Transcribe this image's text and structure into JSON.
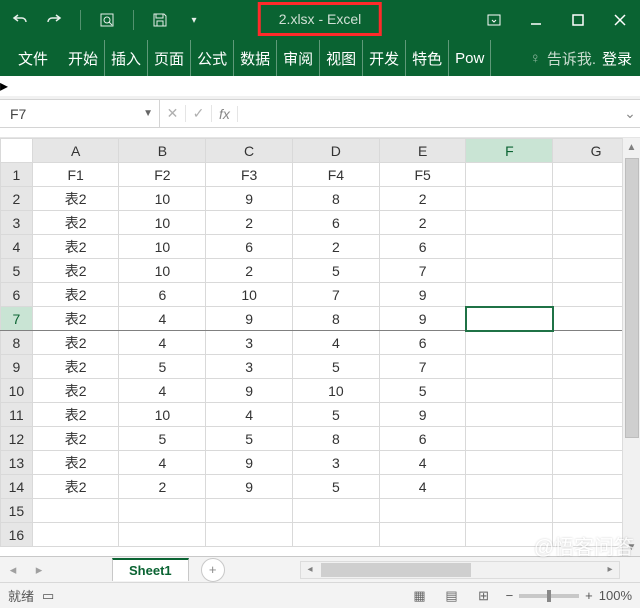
{
  "title": "2.xlsx - Excel",
  "ribbon_tabs": [
    "文件",
    "开始",
    "插入",
    "页面",
    "公式",
    "数据",
    "审阅",
    "视图",
    "开发",
    "特色",
    "Pow"
  ],
  "tell_me": "告诉我.",
  "login": "登录",
  "namebox": "F7",
  "formula": "",
  "columns": [
    "A",
    "B",
    "C",
    "D",
    "E",
    "F",
    "G"
  ],
  "row_numbers": [
    1,
    2,
    3,
    4,
    5,
    6,
    7,
    8,
    9,
    10,
    11,
    12,
    13,
    14,
    15,
    16
  ],
  "active_col": "F",
  "active_row": 7,
  "rows": [
    [
      "F1",
      "F2",
      "F3",
      "F4",
      "F5",
      "",
      ""
    ],
    [
      "表2",
      "10",
      "9",
      "8",
      "2",
      "",
      ""
    ],
    [
      "表2",
      "10",
      "2",
      "6",
      "2",
      "",
      ""
    ],
    [
      "表2",
      "10",
      "6",
      "2",
      "6",
      "",
      ""
    ],
    [
      "表2",
      "10",
      "2",
      "5",
      "7",
      "",
      ""
    ],
    [
      "表2",
      "6",
      "10",
      "7",
      "9",
      "",
      ""
    ],
    [
      "表2",
      "4",
      "9",
      "8",
      "9",
      "",
      ""
    ],
    [
      "表2",
      "4",
      "3",
      "4",
      "6",
      "",
      ""
    ],
    [
      "表2",
      "5",
      "3",
      "5",
      "7",
      "",
      ""
    ],
    [
      "表2",
      "4",
      "9",
      "10",
      "5",
      "",
      ""
    ],
    [
      "表2",
      "10",
      "4",
      "5",
      "9",
      "",
      ""
    ],
    [
      "表2",
      "5",
      "5",
      "8",
      "6",
      "",
      ""
    ],
    [
      "表2",
      "4",
      "9",
      "3",
      "4",
      "",
      ""
    ],
    [
      "表2",
      "2",
      "9",
      "5",
      "4",
      "",
      ""
    ],
    [
      "",
      "",
      "",
      "",
      "",
      "",
      ""
    ],
    [
      "",
      "",
      "",
      "",
      "",
      "",
      ""
    ]
  ],
  "sheet_tab": "Sheet1",
  "status": "就绪",
  "zoom": "100%",
  "watermark": "@悟客问答",
  "chart_data": {
    "type": "table",
    "columns": [
      "F1",
      "F2",
      "F3",
      "F4",
      "F5"
    ],
    "data": [
      [
        "表2",
        10,
        9,
        8,
        2
      ],
      [
        "表2",
        10,
        2,
        6,
        2
      ],
      [
        "表2",
        10,
        6,
        2,
        6
      ],
      [
        "表2",
        10,
        2,
        5,
        7
      ],
      [
        "表2",
        6,
        10,
        7,
        9
      ],
      [
        "表2",
        4,
        9,
        8,
        9
      ],
      [
        "表2",
        4,
        3,
        4,
        6
      ],
      [
        "表2",
        5,
        3,
        5,
        7
      ],
      [
        "表2",
        4,
        9,
        10,
        5
      ],
      [
        "表2",
        10,
        4,
        5,
        9
      ],
      [
        "表2",
        5,
        5,
        8,
        6
      ],
      [
        "表2",
        4,
        9,
        3,
        4
      ],
      [
        "表2",
        2,
        9,
        5,
        4
      ]
    ]
  }
}
